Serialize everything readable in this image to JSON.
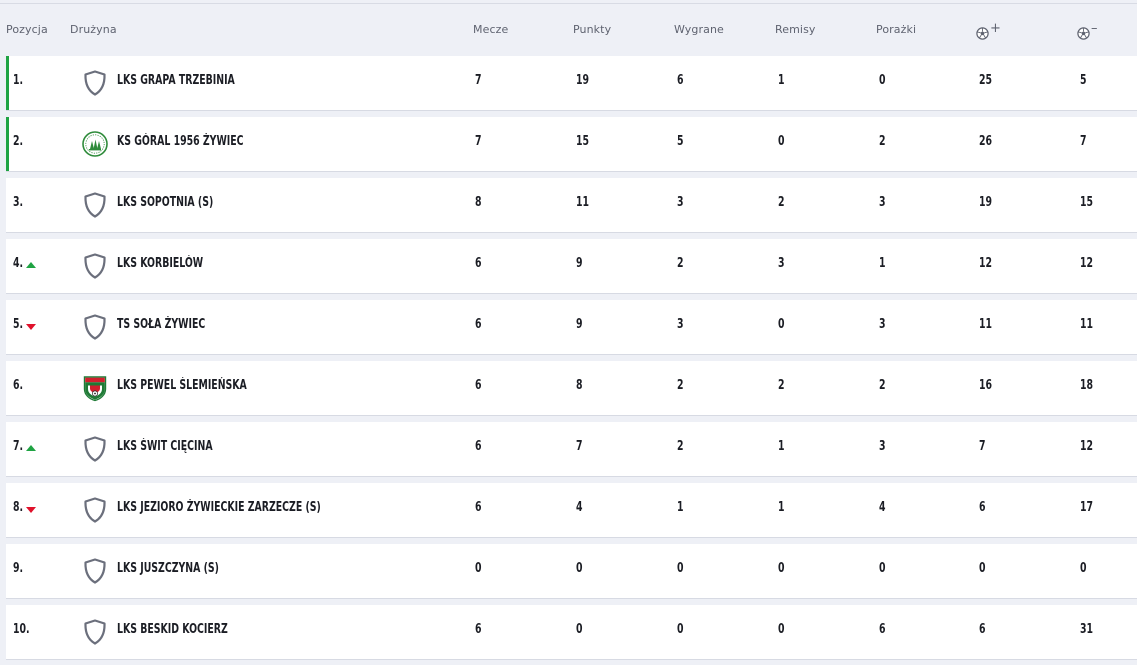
{
  "headers": {
    "position": "Pozycja",
    "team": "Drużyna",
    "played": "Mecze",
    "points": "Punkty",
    "wins": "Wygrane",
    "draws": "Remisy",
    "losses": "Porażki",
    "goals_for_sign": "+",
    "goals_against_sign": "–"
  },
  "colors": {
    "promotion": "#1fa343",
    "trend_up": "#1fa343",
    "trend_down": "#e0112b"
  },
  "rows": [
    {
      "pos": "1.",
      "trend": "",
      "crest": "shield-icon",
      "team": "LKS GRAPA TRZEBINIA",
      "played": "7",
      "points": "19",
      "wins": "6",
      "draws": "1",
      "losses": "0",
      "gf": "25",
      "ga": "5",
      "promo": true
    },
    {
      "pos": "2.",
      "trend": "",
      "crest": "goral-crest-icon",
      "team": "KS GÓRAL 1956 ŻYWIEC",
      "played": "7",
      "points": "15",
      "wins": "5",
      "draws": "0",
      "losses": "2",
      "gf": "26",
      "ga": "7",
      "promo": true
    },
    {
      "pos": "3.",
      "trend": "",
      "crest": "shield-icon",
      "team": "LKS SOPOTNIA (S)",
      "played": "8",
      "points": "11",
      "wins": "3",
      "draws": "2",
      "losses": "3",
      "gf": "19",
      "ga": "15",
      "promo": false
    },
    {
      "pos": "4.",
      "trend": "up",
      "crest": "shield-icon",
      "team": "LKS KORBIELÓW",
      "played": "6",
      "points": "9",
      "wins": "2",
      "draws": "3",
      "losses": "1",
      "gf": "12",
      "ga": "12",
      "promo": false
    },
    {
      "pos": "5.",
      "trend": "down",
      "crest": "shield-icon",
      "team": "TS SOŁA ŻYWIEC",
      "played": "6",
      "points": "9",
      "wins": "3",
      "draws": "0",
      "losses": "3",
      "gf": "11",
      "ga": "11",
      "promo": false
    },
    {
      "pos": "6.",
      "trend": "",
      "crest": "pewel-crest-icon",
      "team": "LKS PEWEL ŚLEMIEŃSKA",
      "played": "6",
      "points": "8",
      "wins": "2",
      "draws": "2",
      "losses": "2",
      "gf": "16",
      "ga": "18",
      "promo": false
    },
    {
      "pos": "7.",
      "trend": "up",
      "crest": "shield-icon",
      "team": "LKS ŚWIT CIĘCINA",
      "played": "6",
      "points": "7",
      "wins": "2",
      "draws": "1",
      "losses": "3",
      "gf": "7",
      "ga": "12",
      "promo": false
    },
    {
      "pos": "8.",
      "trend": "down",
      "crest": "shield-icon",
      "team": "LKS JEZIORO ŻYWIECKIE ZARZECZE (S)",
      "played": "6",
      "points": "4",
      "wins": "1",
      "draws": "1",
      "losses": "4",
      "gf": "6",
      "ga": "17",
      "promo": false
    },
    {
      "pos": "9.",
      "trend": "",
      "crest": "shield-icon",
      "team": "LKS JUSZCZYNA (S)",
      "played": "0",
      "points": "0",
      "wins": "0",
      "draws": "0",
      "losses": "0",
      "gf": "0",
      "ga": "0",
      "promo": false
    },
    {
      "pos": "10.",
      "trend": "",
      "crest": "shield-icon",
      "team": "LKS BESKID KOCIERZ",
      "played": "6",
      "points": "0",
      "wins": "0",
      "draws": "0",
      "losses": "6",
      "gf": "6",
      "ga": "31",
      "promo": false
    }
  ]
}
